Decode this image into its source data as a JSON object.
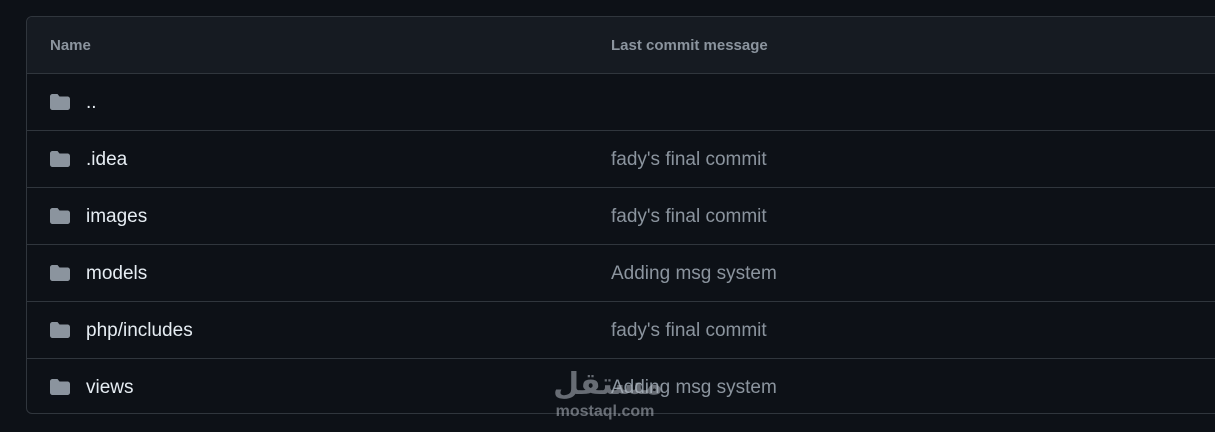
{
  "table": {
    "headers": {
      "name": "Name",
      "last_commit_message": "Last commit message"
    },
    "rows": [
      {
        "name": "..",
        "message": "",
        "icon": "folder-icon"
      },
      {
        "name": ".idea",
        "message": "fady's final commit",
        "icon": "folder-icon"
      },
      {
        "name": "images",
        "message": "fady's final commit",
        "icon": "folder-icon"
      },
      {
        "name": "models",
        "message": "Adding msg system",
        "icon": "folder-icon"
      },
      {
        "name": "php/includes",
        "message": "fady's final commit",
        "icon": "folder-icon"
      },
      {
        "name": "views",
        "message": "Adding msg system",
        "icon": "folder-icon"
      }
    ]
  },
  "watermark": {
    "logo_text": "مستقل",
    "url_text": "mostaql.com"
  },
  "colors": {
    "background": "#0d1117",
    "header_background": "#161b22",
    "border": "#30363d",
    "primary_text": "#e6edf3",
    "muted_text": "#8b949e",
    "folder_icon": "#8b949e"
  }
}
